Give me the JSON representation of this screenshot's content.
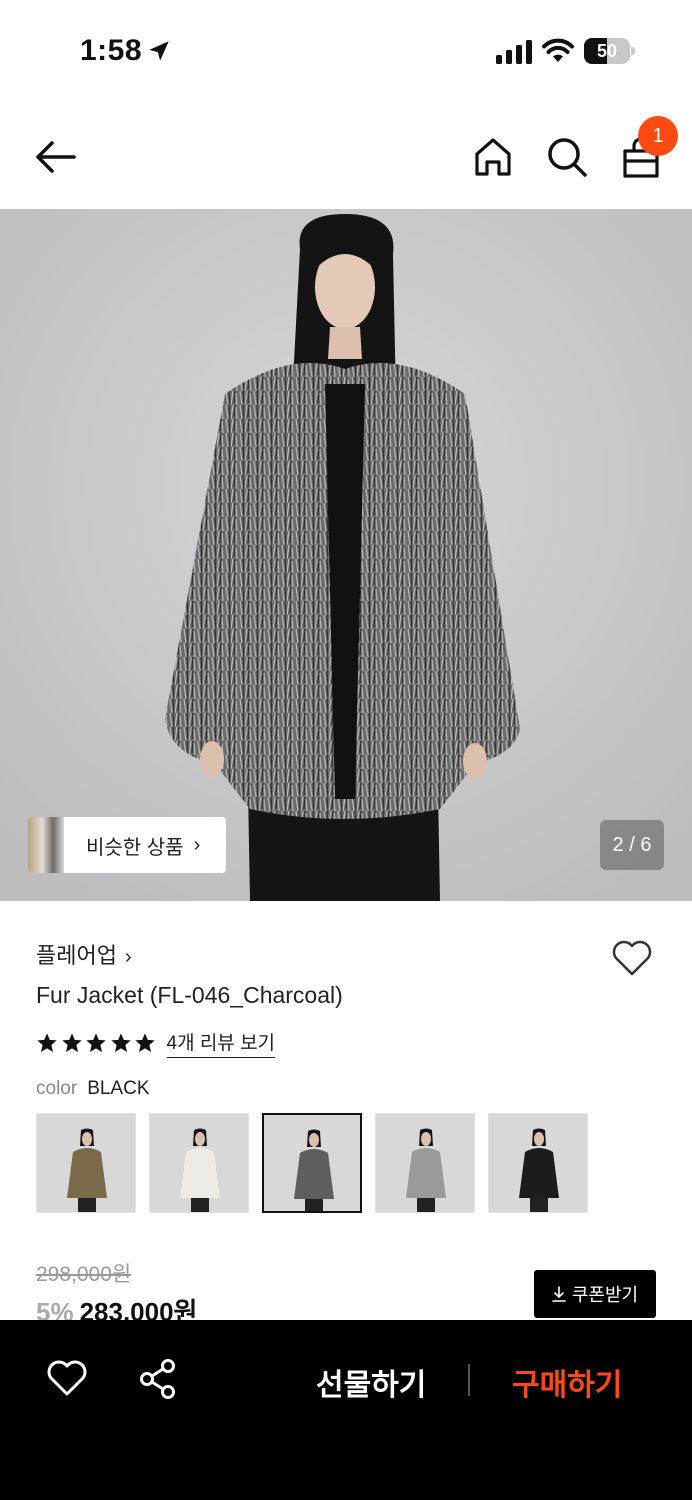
{
  "status_bar": {
    "time": "1:58",
    "battery": "50",
    "battery_level": 0.5
  },
  "nav": {
    "cart_count": "1"
  },
  "hero": {
    "similar_label": "비슷한 상품",
    "similar_chevron": "›",
    "image_counter": "2 / 6"
  },
  "product": {
    "brand": "플레어업",
    "brand_chevron": "›",
    "name": "Fur Jacket (FL-046_Charcoal)",
    "rating_stars": 5,
    "review_link": "4개 리뷰 보기",
    "color_key": "color",
    "color_value": "BLACK",
    "swatches": [
      "brown",
      "white",
      "charcoal",
      "gray",
      "black"
    ],
    "selected_swatch": 2,
    "original_price": "298,000원",
    "discount": "5%",
    "sale_price": "283,000원",
    "coupon_label": "쿠폰받기"
  },
  "bottom_bar": {
    "gift_label": "선물하기",
    "buy_label": "구매하기",
    "accent_color": "#ff4b10"
  }
}
